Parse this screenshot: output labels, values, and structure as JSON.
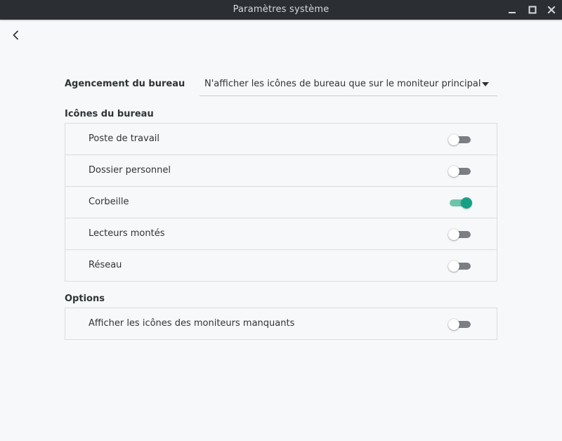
{
  "window": {
    "title": "Paramètres système"
  },
  "layout": {
    "label": "Agencement du bureau",
    "selected": "N'afficher les icônes de bureau que sur le moniteur principal"
  },
  "desktop_icons": {
    "title": "Icônes du bureau",
    "items": [
      {
        "label": "Poste de travail",
        "enabled": false
      },
      {
        "label": "Dossier personnel",
        "enabled": false
      },
      {
        "label": "Corbeille",
        "enabled": true
      },
      {
        "label": "Lecteurs montés",
        "enabled": false
      },
      {
        "label": "Réseau",
        "enabled": false
      }
    ]
  },
  "options": {
    "title": "Options",
    "items": [
      {
        "label": "Afficher les icônes des moniteurs manquants",
        "enabled": false
      }
    ]
  },
  "colors": {
    "titlebar_bg": "#2b2e33",
    "page_bg": "#f7f8fa",
    "accent": "#16a085",
    "switch_off": "#7b7f84"
  },
  "icons": {
    "back": "chevron-left-icon",
    "minimize": "minimize-icon",
    "maximize": "maximize-icon",
    "close": "close-icon",
    "dropdown": "triangle-down-icon"
  }
}
